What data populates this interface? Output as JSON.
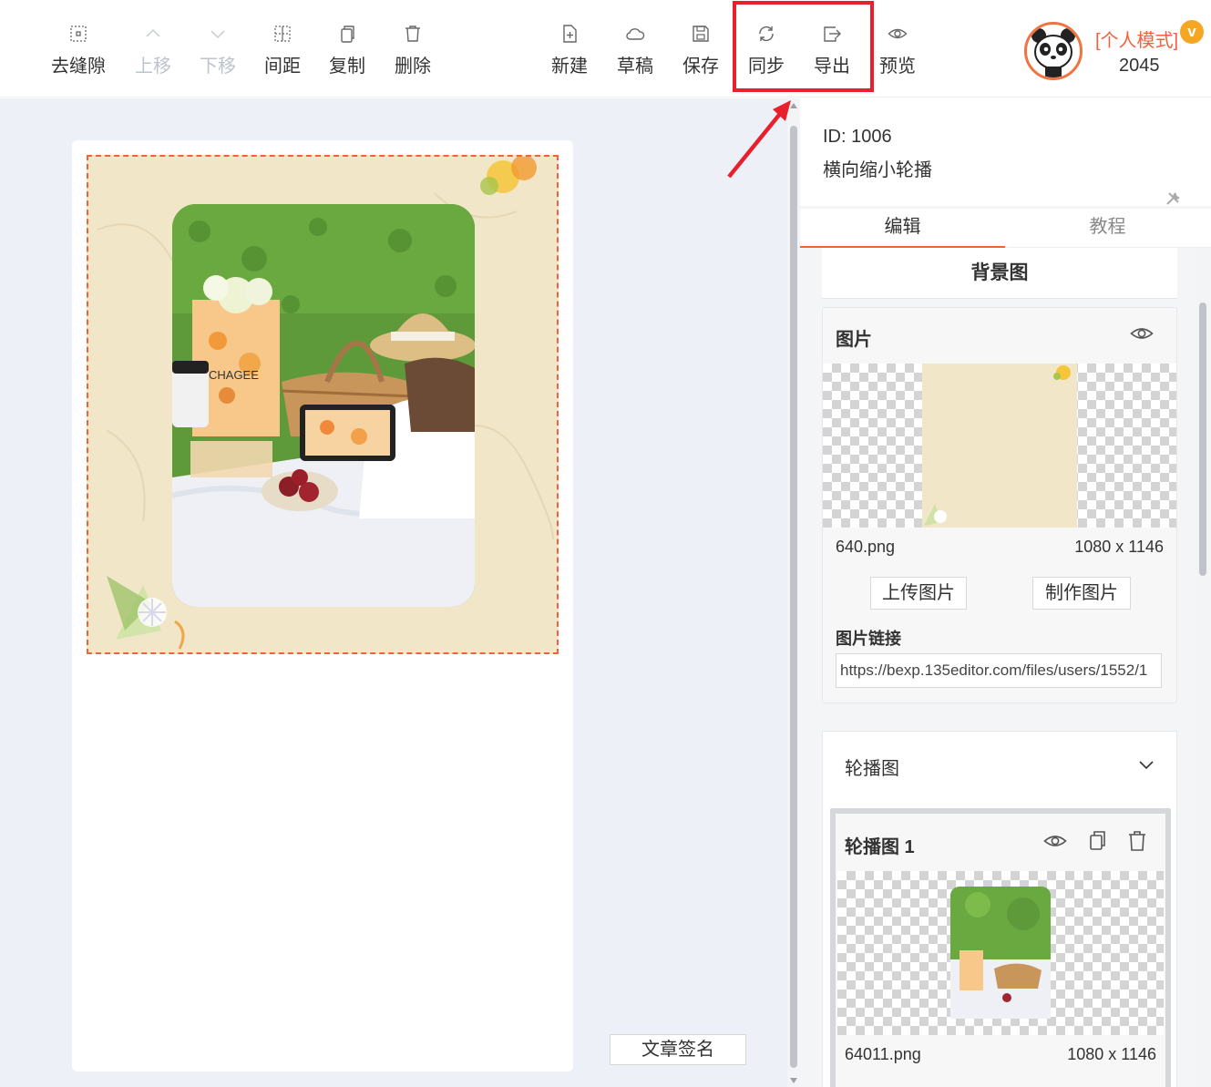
{
  "toolbar": {
    "remove_gap": "去缝隙",
    "move_up": "上移",
    "move_down": "下移",
    "spacing": "间距",
    "copy": "复制",
    "delete": "删除",
    "new": "新建",
    "draft": "草稿",
    "save": "保存",
    "sync": "同步",
    "export": "导出",
    "preview": "预览"
  },
  "user": {
    "mode": "[个人模式]",
    "badge": "v",
    "count": "2045"
  },
  "canvas": {
    "photo_text": "CHAGEE",
    "signature_button": "文章签名"
  },
  "panel": {
    "id_line": "ID: 1006",
    "template_name": "横向缩小轮播",
    "tabs": {
      "edit": "编辑",
      "tutorial": "教程"
    },
    "section_title": "背景图",
    "image_card": {
      "title": "图片",
      "file_name": "640.png",
      "file_size": "1080 x 1146",
      "upload_button": "上传图片",
      "make_button": "制作图片",
      "link_label": "图片链接",
      "link_value": "https://bexp.135editor.com/files/users/1552/1"
    },
    "carousel": {
      "title": "轮播图",
      "slide_title": "轮播图 1",
      "slide_file": "64011.png",
      "slide_size": "1080 x 1146"
    }
  },
  "colors": {
    "accent": "#f0623a",
    "highlight": "#e8202e",
    "mode_text": "#f2603e",
    "badge": "#f5a623"
  }
}
